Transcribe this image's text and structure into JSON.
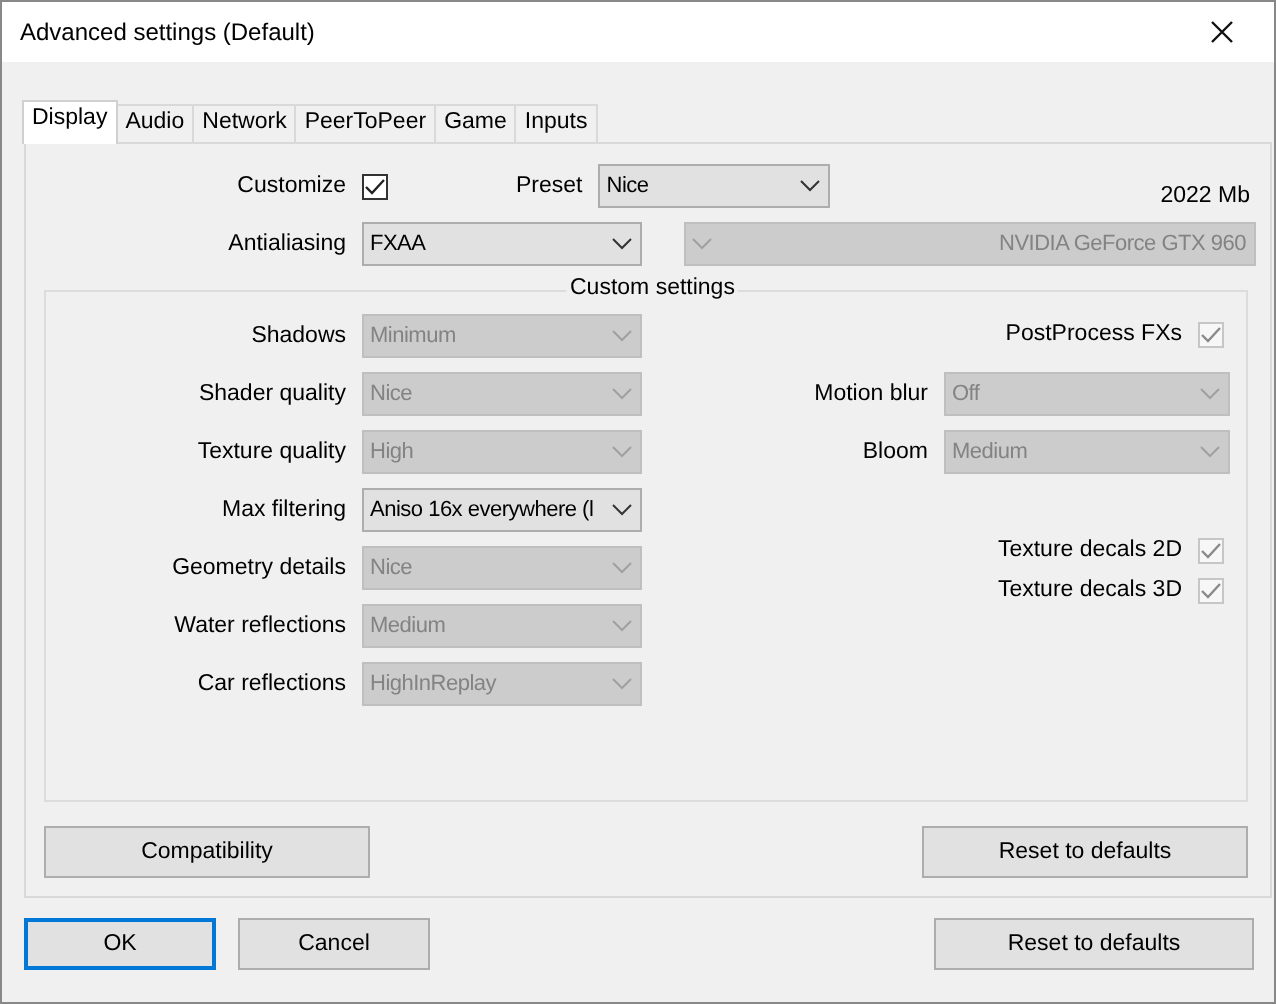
{
  "window": {
    "title": "Advanced settings (Default)"
  },
  "tabs": [
    {
      "label": "Display",
      "selected": true
    },
    {
      "label": "Audio",
      "selected": false
    },
    {
      "label": "Network",
      "selected": false
    },
    {
      "label": "PeerToPeer",
      "selected": false
    },
    {
      "label": "Game",
      "selected": false
    },
    {
      "label": "Inputs",
      "selected": false
    }
  ],
  "customize": {
    "label": "Customize",
    "checked": true
  },
  "preset": {
    "label": "Preset",
    "value": "Nice",
    "disabled": false
  },
  "video_memory": "2022 Mb",
  "antialiasing": {
    "label": "Antialiasing",
    "value": "FXAA",
    "disabled": false
  },
  "gpu": {
    "value": "NVIDIA GeForce GTX 960",
    "disabled": true
  },
  "custom_settings": {
    "title": "Custom settings",
    "left": [
      {
        "label": "Shadows",
        "value": "Minimum",
        "disabled": true
      },
      {
        "label": "Shader quality",
        "value": "Nice",
        "disabled": true
      },
      {
        "label": "Texture quality",
        "value": "High",
        "disabled": true
      },
      {
        "label": "Max filtering",
        "value": "Aniso 16x everywhere (l",
        "disabled": false
      },
      {
        "label": "Geometry details",
        "value": "Nice",
        "disabled": true
      },
      {
        "label": "Water reflections",
        "value": "Medium",
        "disabled": true
      },
      {
        "label": "Car reflections",
        "value": "HighInReplay",
        "disabled": true
      }
    ],
    "right": [
      {
        "kind": "checkbox",
        "label": "PostProcess FXs",
        "checked": true,
        "disabled": true
      },
      {
        "kind": "dropdown",
        "label": "Motion blur",
        "value": "Off",
        "disabled": true
      },
      {
        "kind": "dropdown",
        "label": "Bloom",
        "value": "Medium",
        "disabled": true
      },
      {
        "kind": "checkbox",
        "label": "Texture decals 2D",
        "checked": true,
        "disabled": true
      },
      {
        "kind": "checkbox",
        "label": "Texture decals 3D",
        "checked": true,
        "disabled": true
      }
    ]
  },
  "panel_buttons": [
    "Compatibility",
    "Reset to defaults"
  ],
  "dialog_buttons": [
    {
      "label": "OK",
      "focused": true
    },
    {
      "label": "Cancel",
      "focused": false
    },
    {
      "label": "Reset to defaults",
      "focused": false
    }
  ]
}
